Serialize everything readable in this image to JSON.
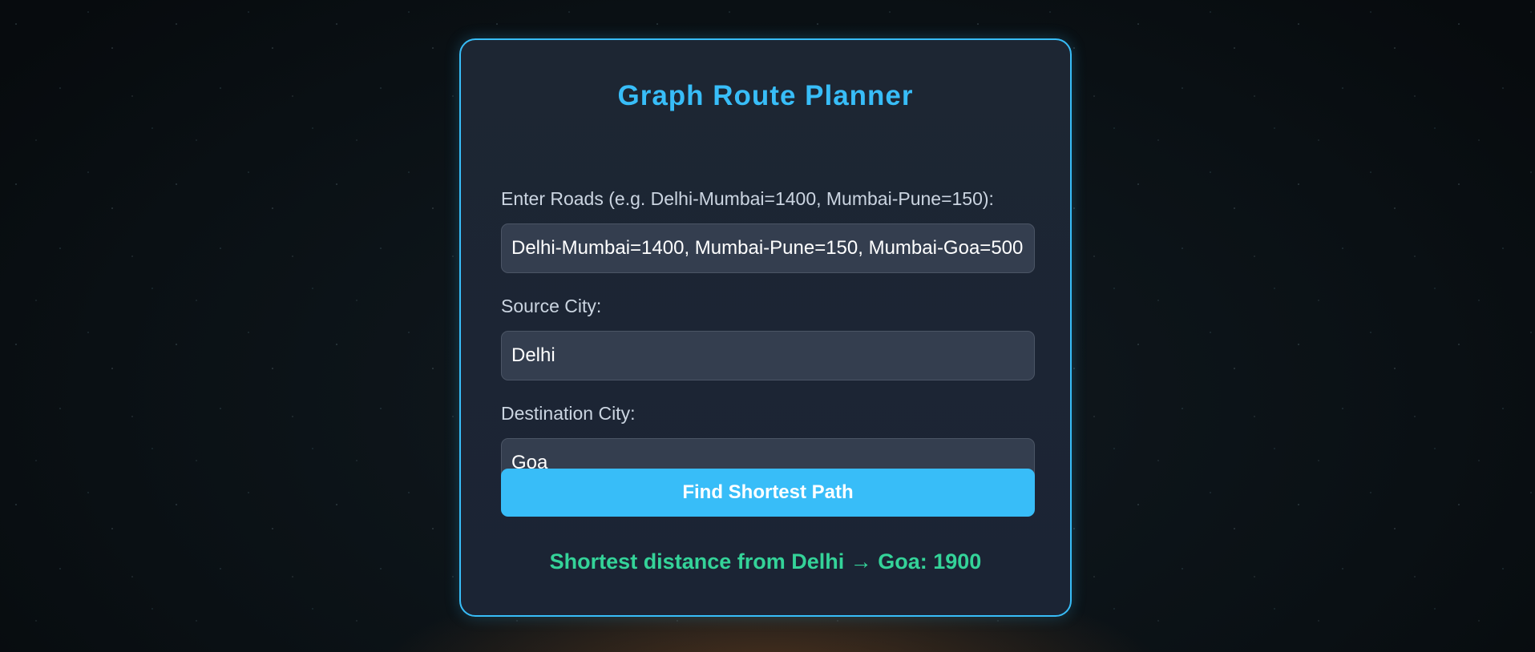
{
  "app": {
    "title": "Graph Route Planner"
  },
  "form": {
    "roads_label": "Enter Roads (e.g. Delhi-Mumbai=1400, Mumbai-Pune=150):",
    "roads_value": "Delhi-Mumbai=1400, Mumbai-Pune=150, Mumbai-Goa=500",
    "source_label": "Source City:",
    "source_value": "Delhi",
    "destination_label": "Destination City:",
    "destination_value": "Goa",
    "submit_label": "Find Shortest Path"
  },
  "result": {
    "text": "Shortest distance from Delhi → Goa: 1900"
  },
  "colors": {
    "accent": "#38bdf8",
    "success": "#34d399",
    "card_bg": "#1d2633",
    "field_bg": "#343e4f"
  }
}
